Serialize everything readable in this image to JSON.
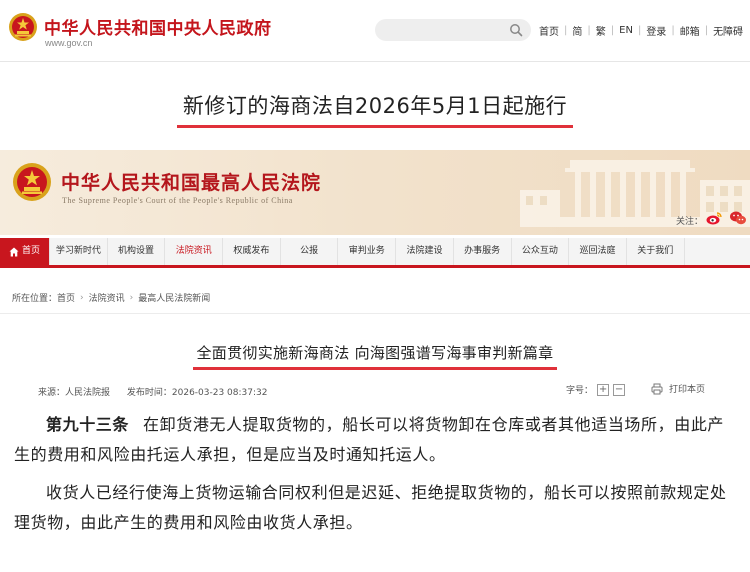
{
  "gov_header": {
    "title": "中华人民共和国中央人民政府",
    "url": "www.gov.cn",
    "search_placeholder": "",
    "nav": [
      "首页",
      "简",
      "繁",
      "EN",
      "登录",
      "邮箱",
      "无障碍"
    ]
  },
  "headline": "新修订的海商法自2026年5月1日起施行",
  "court_header": {
    "title": "中华人民共和国最高人民法院",
    "subtitle": "The Supreme People's Court of the People's Republic of China",
    "follow_label": "关注：",
    "icons": [
      "weibo-icon",
      "wechat-icon"
    ]
  },
  "court_nav": [
    "首页",
    "学习新时代",
    "机构设置",
    "法院资讯",
    "权威发布",
    "公报",
    "审判业务",
    "法院建设",
    "办事服务",
    "公众互动",
    "巡回法庭",
    "关于我们"
  ],
  "breadcrumb": {
    "label": "所在位置：",
    "items": [
      "首页",
      "法院资讯",
      "最高人民法院新闻"
    ]
  },
  "article": {
    "title": "全面贯彻实施新海商法 向海图强谱写海事审判新篇章",
    "source": "来源：人民法院报",
    "published": "发布时间：2026-03-23 08:37:32",
    "font_size_label": "字号：",
    "font_plus": "+",
    "font_minus": "−",
    "print_label": "打印本页",
    "clause_number": "第九十三条",
    "paragraph_1": "在卸货港无人提取货物的，船长可以将货物卸在仓库或者其他适当场所，由此产生的费用和风险由托运人承担，但是应当及时通知托运人。",
    "paragraph_2": "收货人已经行使海上货物运输合同权利但是迟延、拒绝提取货物的，船长可以按照前款规定处理货物，由此产生的费用和风险由收货人承担。"
  },
  "colors": {
    "brand_red": "#c8161e",
    "title_red": "#c4151c",
    "underline_red": "#e0313a",
    "court_banner": "#f2e2cc"
  }
}
